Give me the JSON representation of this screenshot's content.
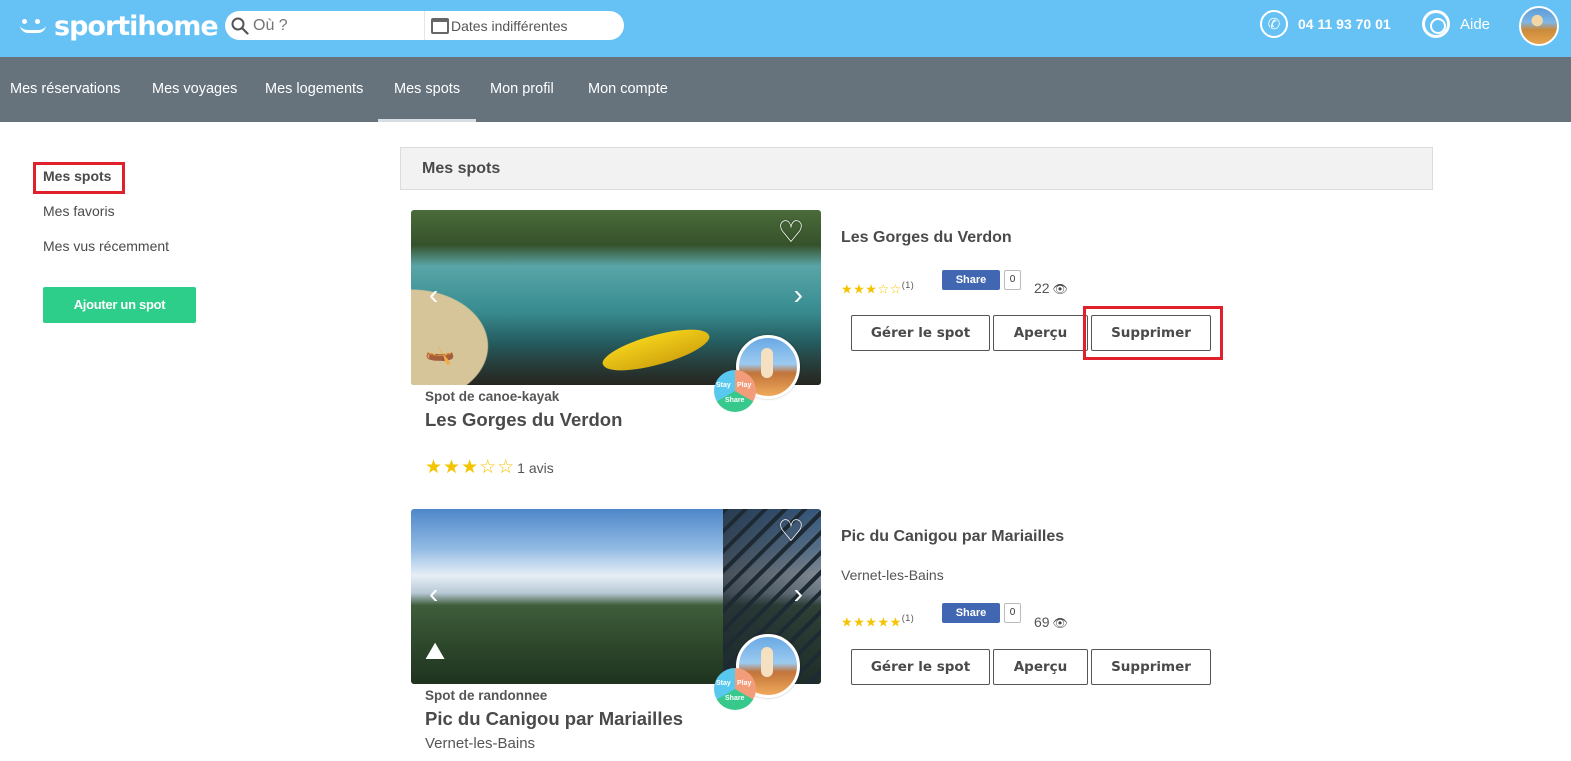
{
  "header": {
    "logo": "sportihome",
    "search_placeholder": "Où ?",
    "dates_label": "Dates indifférentes",
    "phone": "04 11 93 70 01",
    "help": "Aide"
  },
  "nav": {
    "items": [
      {
        "label": "Mes réservations"
      },
      {
        "label": "Mes voyages"
      },
      {
        "label": "Mes logements"
      },
      {
        "label": "Mes spots"
      },
      {
        "label": "Mon profil"
      },
      {
        "label": "Mon compte"
      }
    ],
    "active_index": 3
  },
  "sidebar": {
    "items": [
      {
        "label": "Mes spots"
      },
      {
        "label": "Mes favoris"
      },
      {
        "label": "Mes vus récemment"
      }
    ],
    "add_button": "Ajouter un spot"
  },
  "section": {
    "title": "Mes spots"
  },
  "spots": [
    {
      "type": "Spot de canoe-kayak",
      "title": "Les Gorges du Verdon",
      "place": "",
      "rating": 3,
      "rating_count": "(1)",
      "reviews": "1 avis",
      "share_label": "Share",
      "share_count": "0",
      "views": "22",
      "sport_icon": "kayak-icon",
      "buttons": {
        "manage": "Gérer le spot",
        "preview": "Aperçu",
        "delete": "Supprimer"
      }
    },
    {
      "type": "Spot de randonnee",
      "title": "Pic du Canigou par Mariailles",
      "place": "Vernet-les-Bains",
      "rating": 5,
      "rating_count": "(1)",
      "reviews": "",
      "share_label": "Share",
      "share_count": "0",
      "views": "69",
      "sport_icon": "hiking-icon",
      "buttons": {
        "manage": "Gérer le spot",
        "preview": "Aperçu",
        "delete": "Supprimer"
      }
    }
  ],
  "badge": {
    "stay": "Stay",
    "play": "Play",
    "share": "Share"
  },
  "colors": {
    "header": "#66c2f5",
    "subnav": "#66737d",
    "accent_green": "#2dce89",
    "highlight_red": "#e0202a",
    "star": "#f5c400",
    "facebook": "#4267b2"
  }
}
